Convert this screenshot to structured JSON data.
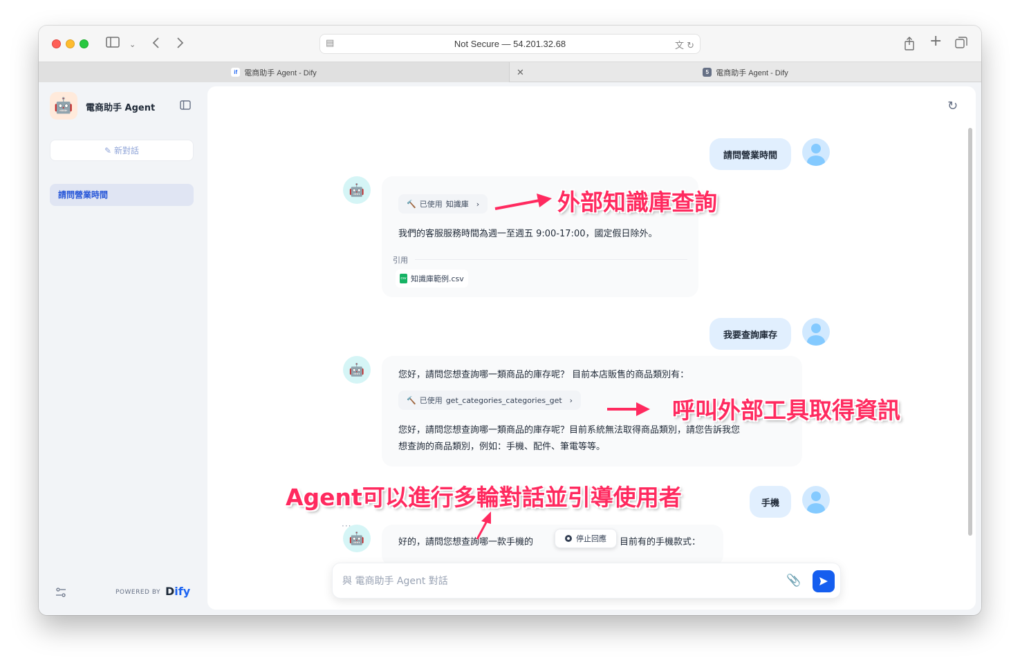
{
  "browser": {
    "url_display": "Not Secure — 54.201.32.68",
    "tabs": [
      {
        "title": "電商助手 Agent - Dify",
        "favicon_text": "if",
        "favicon_color": "#1c64f2"
      },
      {
        "title": "電商助手 Agent - Dify",
        "favicon_text": "5",
        "favicon_color": "#667085"
      }
    ],
    "icons": [
      "sidebar-toggle-icon",
      "chevron-down-icon",
      "back-icon",
      "forward-icon",
      "site-icon",
      "translate-icon",
      "reload-icon",
      "share-icon",
      "new-tab-icon",
      "tab-overview-icon",
      "close-tab-icon"
    ]
  },
  "sidebar": {
    "app_name": "電商助手 Agent",
    "app_icon": "🤖",
    "new_chat_label": "新對話",
    "conversations": [
      {
        "title": "請問營業時間"
      }
    ],
    "powered_by": "POWERED BY",
    "brand": "Dify"
  },
  "chat": {
    "messages": [
      {
        "role": "user",
        "text": "請問營業時間"
      },
      {
        "role": "assistant",
        "tool_used": {
          "label": "已使用",
          "name": "知識庫"
        },
        "text": "我們的客服服務時間為週一至週五 9:00-17:00，國定假日除外。",
        "citation_label": "引用",
        "citation_file": "知識庫範例.csv"
      },
      {
        "role": "user",
        "text": "我要查詢庫存"
      },
      {
        "role": "assistant",
        "text_before": "您好，請問您想查詢哪一類商品的庫存呢？ 目前本店販售的商品類別有：",
        "tool_used": {
          "label": "已使用",
          "name": "get_categories_categories_get"
        },
        "text_after_line1": "您好，請問您想查詢哪一類商品的庫存呢？目前系統無法取得商品類別，請您告訴我您",
        "text_after_line2": "想查詢的商品類別，例如：手機、配件、筆電等等。"
      },
      {
        "role": "user",
        "text": "手機"
      },
      {
        "role": "assistant",
        "text_left": "好的，請問您想查詢哪一款手機的",
        "text_right": "目前有的手機款式："
      }
    ],
    "stop_label": "停止回應",
    "composer_placeholder": "與 電商助手 Agent 對話"
  },
  "annotations": {
    "knowledge": "外部知識庫查詢",
    "tool": "呼叫外部工具取得資訊",
    "multiturn": "Agent可以進行多輪對話並引導使用者",
    "color": "#ff2a5f"
  },
  "colors": {
    "accent": "#155eef",
    "user_bubble": "#e1effe",
    "sidebar_active": "#e0e5f3"
  }
}
